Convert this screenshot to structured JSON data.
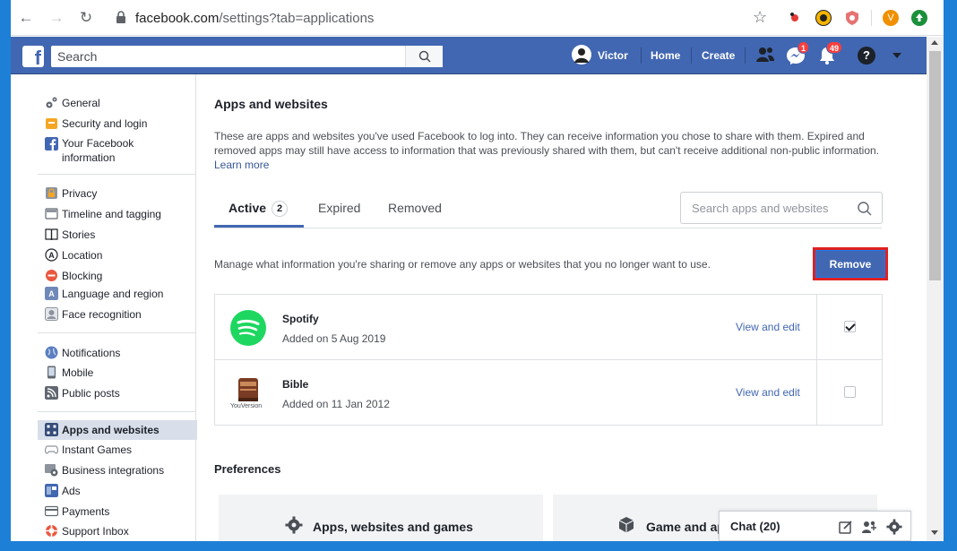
{
  "browser": {
    "url_host": "facebook.com",
    "url_path": "/settings?tab=applications"
  },
  "fb_header": {
    "search_placeholder": "Search",
    "user_name": "Victor",
    "home_label": "Home",
    "create_label": "Create",
    "messages_badge": "1",
    "notifications_badge": "49"
  },
  "sidebar": {
    "items": [
      {
        "label": "General"
      },
      {
        "label": "Security and login"
      },
      {
        "label": "Your Facebook information"
      },
      {
        "label": "Privacy"
      },
      {
        "label": "Timeline and tagging"
      },
      {
        "label": "Stories"
      },
      {
        "label": "Location"
      },
      {
        "label": "Blocking"
      },
      {
        "label": "Language and region"
      },
      {
        "label": "Face recognition"
      },
      {
        "label": "Notifications"
      },
      {
        "label": "Mobile"
      },
      {
        "label": "Public posts"
      },
      {
        "label": "Apps and websites"
      },
      {
        "label": "Instant Games"
      },
      {
        "label": "Business integrations"
      },
      {
        "label": "Ads"
      },
      {
        "label": "Payments"
      },
      {
        "label": "Support Inbox"
      }
    ]
  },
  "main": {
    "title": "Apps and websites",
    "description": "These are apps and websites you've used Facebook to log into. They can receive information you chose to share with them. Expired and removed apps may still have access to information that was previously shared with them, but can't receive additional non-public information.",
    "learn_more": "Learn more",
    "tabs": [
      {
        "label": "Active",
        "count": "2"
      },
      {
        "label": "Expired"
      },
      {
        "label": "Removed"
      }
    ],
    "search_placeholder": "Search apps and websites",
    "manage_text": "Manage what information you're sharing or remove any apps or websites that you no longer want to use.",
    "remove_label": "Remove",
    "apps": [
      {
        "name": "Spotify",
        "added": "Added on 5 Aug 2019",
        "edit": "View and edit",
        "checked": true
      },
      {
        "name": "Bible",
        "added": "Added on 11 Jan 2012",
        "edit": "View and edit",
        "checked": false,
        "icon_caption": "YouVersion"
      }
    ],
    "preferences_title": "Preferences",
    "pref_cards": [
      {
        "label": "Apps, websites and games"
      },
      {
        "label": "Game and ap"
      }
    ]
  },
  "chat": {
    "label": "Chat (20)"
  }
}
